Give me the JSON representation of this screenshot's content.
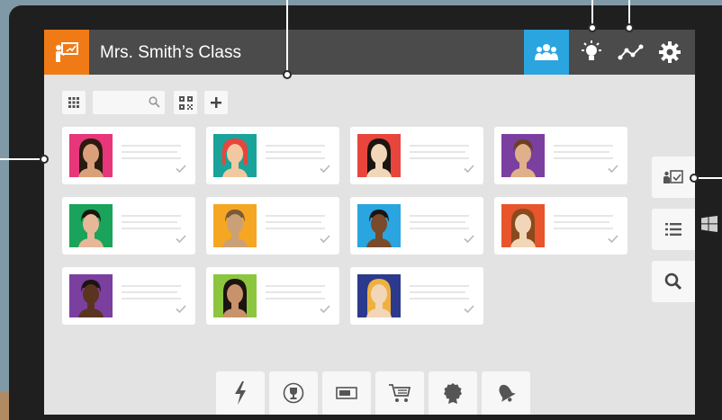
{
  "header": {
    "title": "Mrs. Smith’s Class",
    "icons": [
      "teacher-board-icon",
      "class-group-icon",
      "lightbulb-icon",
      "analytics-icon",
      "gear-icon"
    ]
  },
  "toolbar": {
    "icons": [
      "grid-view-icon",
      "search-icon",
      "qr-code-icon",
      "plus-icon"
    ],
    "search_placeholder": ""
  },
  "students": [
    {
      "bg": "#e8367a",
      "skin": "#d9a07a",
      "hair": "#2b1a10",
      "style": "long"
    },
    {
      "bg": "#1aa39a",
      "skin": "#f2c8a0",
      "hair": "#e8453c",
      "style": "bob"
    },
    {
      "bg": "#e8453c",
      "skin": "#f2d6b8",
      "hair": "#1b1412",
      "style": "long"
    },
    {
      "bg": "#7b3fa0",
      "skin": "#e0b08a",
      "hair": "#6b4020",
      "style": "short"
    },
    {
      "bg": "#1aa35a",
      "skin": "#e6b898",
      "hair": "#1b1412",
      "style": "short"
    },
    {
      "bg": "#f5a623",
      "skin": "#caa078",
      "hair": "#7a5a3a",
      "style": "short"
    },
    {
      "bg": "#2aa5df",
      "skin": "#7a4a2a",
      "hair": "#1b1412",
      "style": "short"
    },
    {
      "bg": "#e8542c",
      "skin": "#f2d6b8",
      "hair": "#8a4a1e",
      "style": "long"
    },
    {
      "bg": "#7b3fa0",
      "skin": "#5a341e",
      "hair": "#1b1412",
      "style": "short"
    },
    {
      "bg": "#8cc63f",
      "skin": "#c8926a",
      "hair": "#1b1412",
      "style": "long"
    },
    {
      "bg": "#2b3a8c",
      "skin": "#f2d6b8",
      "hair": "#f0b040",
      "style": "long"
    }
  ],
  "side_tabs": [
    "clipboard-check-icon",
    "list-icon",
    "search-icon"
  ],
  "bottom_tools": [
    "lightning-icon",
    "trophy-icon",
    "timer-bar-icon",
    "cart-icon",
    "badge-icon",
    "bell-icon"
  ],
  "colors": {
    "accent_orange": "#f07b16",
    "accent_blue": "#2aa5df",
    "header_bg": "#4b4b4b",
    "screen_bg": "#e3e3e3"
  }
}
